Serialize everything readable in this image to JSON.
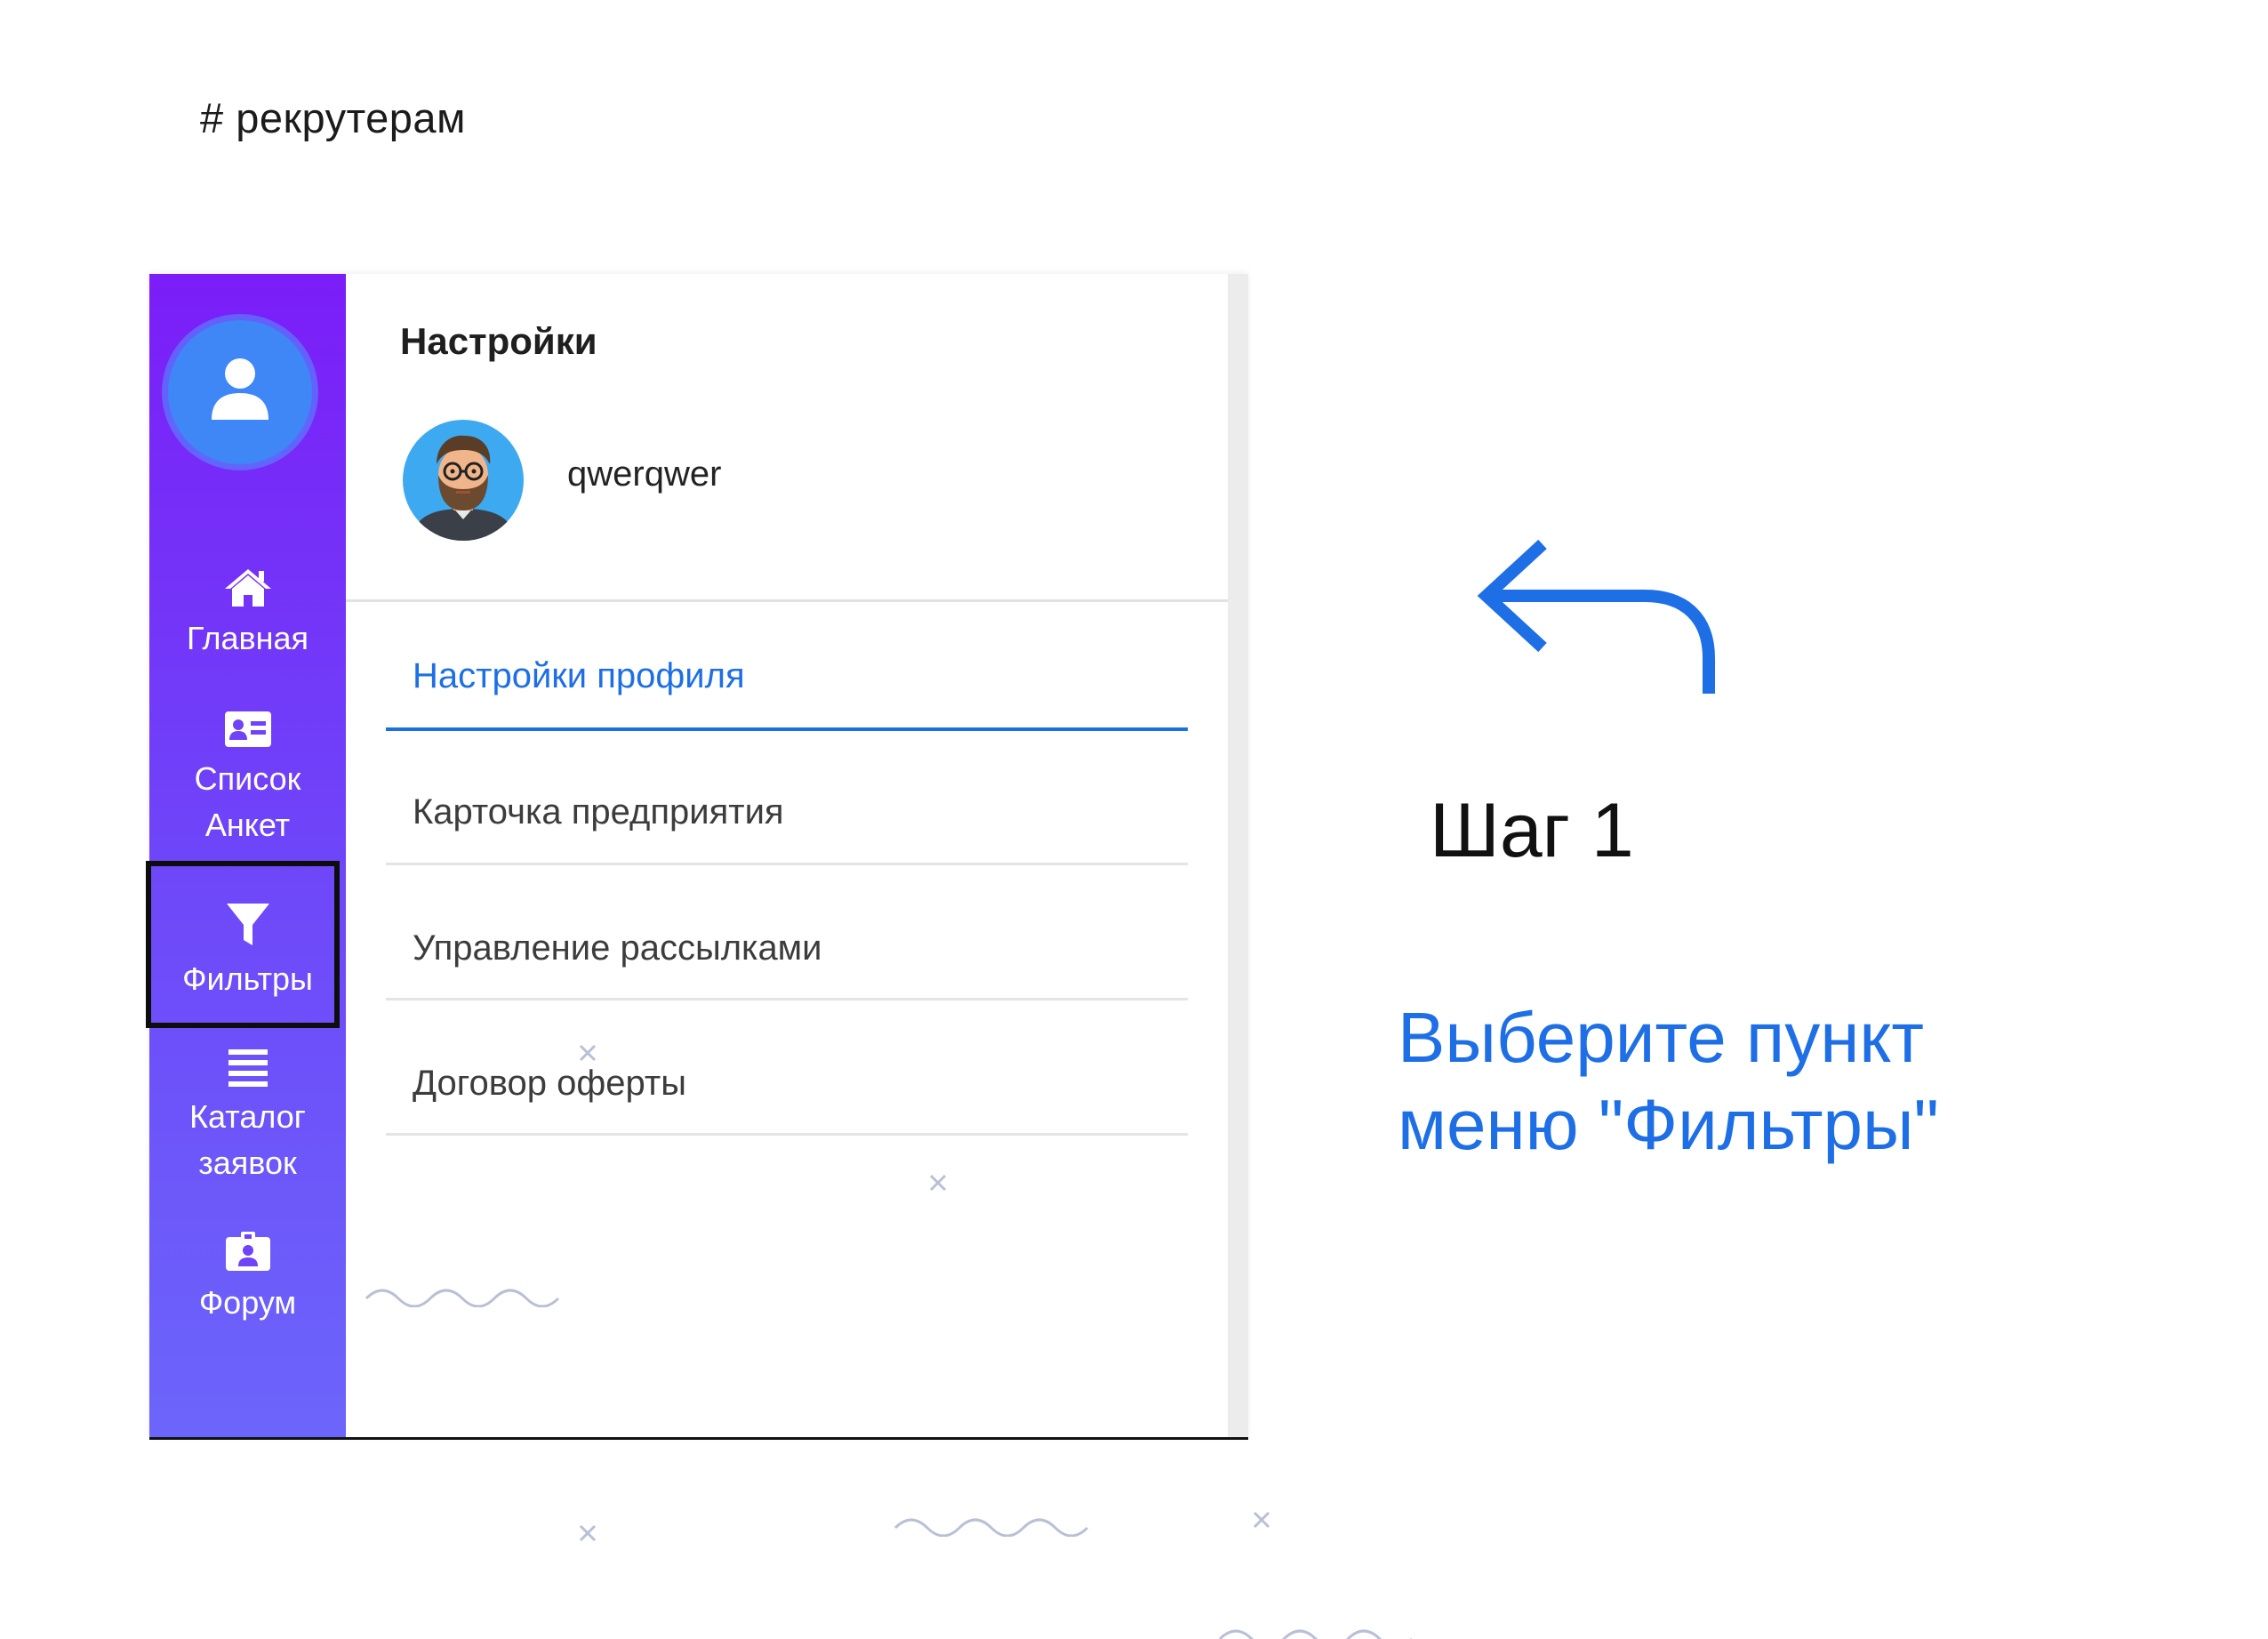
{
  "tag": "# рекрутерам",
  "sidebar": {
    "items": [
      {
        "label": "Главная",
        "icon": "home-icon"
      },
      {
        "label": "Список",
        "label2": "Анкет",
        "icon": "id-card-icon"
      },
      {
        "label": "Фильтры",
        "icon": "filter-icon",
        "highlighted": true
      },
      {
        "label": "Каталог",
        "label2": "заявок",
        "icon": "list-icon"
      },
      {
        "label": "Форум",
        "icon": "badge-icon"
      }
    ]
  },
  "settings": {
    "title": "Настройки",
    "username": "qwerqwer",
    "menu": [
      {
        "label": "Настройки профиля",
        "active": true
      },
      {
        "label": "Карточка предприятия"
      },
      {
        "label": "Управление рассылками"
      },
      {
        "label": "Договор оферты"
      }
    ]
  },
  "instructions": {
    "step": "Шаг 1",
    "line1": "Выберите пункт",
    "line2": "меню \"Фильтры\""
  },
  "colors": {
    "accent": "#1e6fe6",
    "sidebar_top": "#7b1df8",
    "sidebar_bottom": "#6c65fb",
    "highlight_border": "#0d0d0d"
  }
}
